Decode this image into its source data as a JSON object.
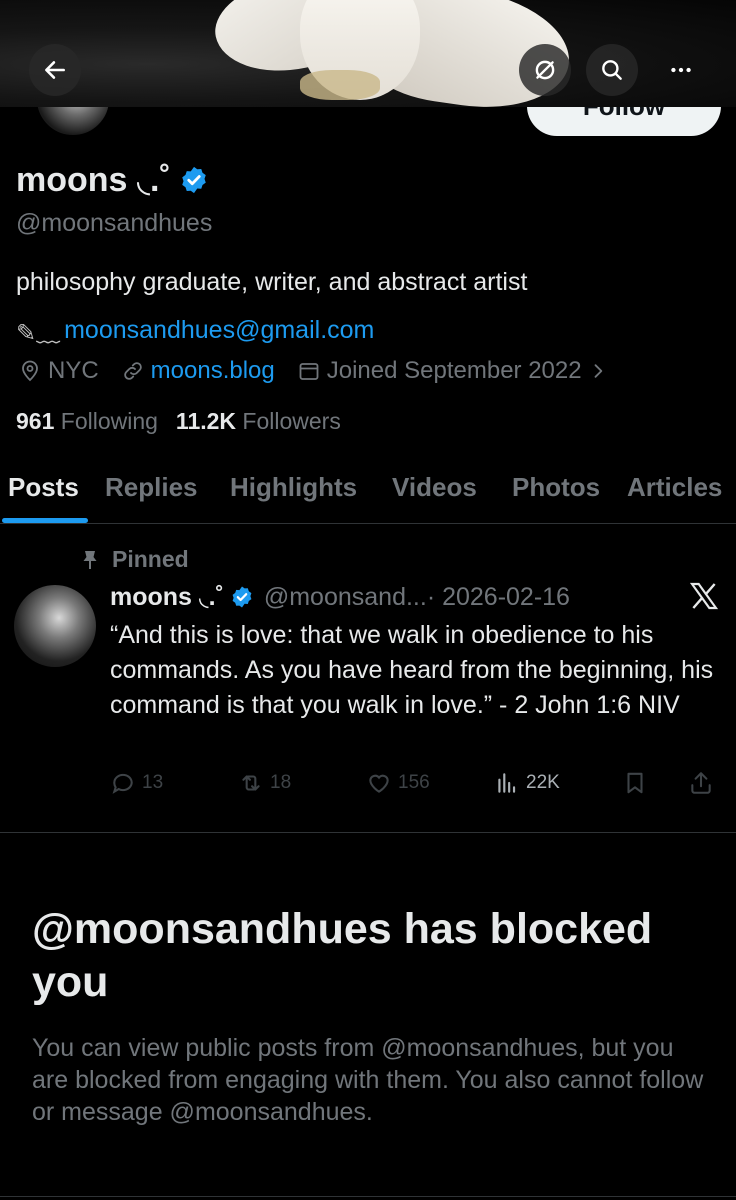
{
  "header": {
    "follow_label": "Follow"
  },
  "profile": {
    "name": "moons ◟.˚",
    "handle": "@moonsandhues",
    "bio": "philosophy graduate, writer, and abstract artist",
    "email_prefix": "✎﹏",
    "email": "moonsandhues@gmail.com",
    "location": "NYC",
    "website": "moons.blog",
    "joined": "Joined September 2022",
    "following_count": "961",
    "following_label": "Following",
    "followers_count": "11.2K",
    "followers_label": "Followers"
  },
  "tabs": [
    {
      "label": "Posts"
    },
    {
      "label": "Replies"
    },
    {
      "label": "Highlights"
    },
    {
      "label": "Videos"
    },
    {
      "label": "Photos"
    },
    {
      "label": "Articles"
    }
  ],
  "pinned_post": {
    "pinned_label": "Pinned",
    "author_name": "moons ◟.˚",
    "author_handle": "@moonsand...",
    "date": "· 2026-02-16",
    "text": "“And this is love: that we walk in obedience to his commands. As you have heard from the beginning, his command is that you walk in love.” - 2 John 1:6 NIV",
    "replies": "13",
    "reposts": "18",
    "likes": "156",
    "views": "22K"
  },
  "blocked": {
    "title": "@moonsandhues has blocked you",
    "message": "You can view public posts from @moonsandhues, but you are blocked from engaging with them. You also cannot follow or message @moonsandhues."
  },
  "colors": {
    "accent": "#1d9bf0",
    "muted": "#71767b",
    "background": "#000000"
  }
}
